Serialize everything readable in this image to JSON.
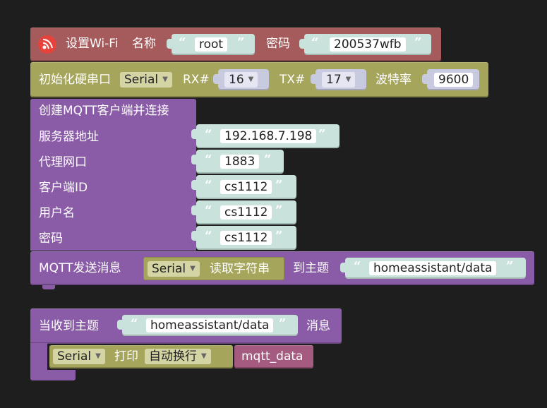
{
  "wifi": {
    "label": "设置Wi-Fi",
    "name_label": "名称",
    "ssid": "root",
    "pass_label": "密码",
    "password": "200537wfb"
  },
  "serial_init": {
    "label": "初始化硬串口",
    "port": "Serial",
    "rx_label": "RX#",
    "rx": "16",
    "tx_label": "TX#",
    "tx": "17",
    "baud_label": "波特率",
    "baud": "9600"
  },
  "mqtt_connect": {
    "title": "创建MQTT客户端并连接",
    "server_label": "服务器地址",
    "server": "192.168.7.198",
    "port_label": "代理网口",
    "port": "1883",
    "client_label": "客户端ID",
    "client": "cs1112",
    "user_label": "用户名",
    "user": "cs1112",
    "pass_label": "密码",
    "password": "cs1112"
  },
  "mqtt_publish": {
    "label": "MQTT发送消息",
    "port": "Serial",
    "read_label": "读取字符串",
    "topic_label": "到主题",
    "topic": "homeassistant/data"
  },
  "mqtt_subscribe": {
    "label": "当收到主题",
    "topic": "homeassistant/data",
    "msg_label": "消息",
    "print_port": "Serial",
    "print_label": "打印",
    "newline": "自动换行",
    "var": "mqtt_data"
  },
  "glyphs": {
    "open_quote": "“",
    "close_quote": "”",
    "arrow": "▼"
  },
  "colors": {
    "wifi_block": "#a55b5b",
    "serial_block": "#a5a55c",
    "mqtt_block": "#8a5ba6",
    "string_socket": "#c9e2db",
    "variable": "#a55b80"
  }
}
